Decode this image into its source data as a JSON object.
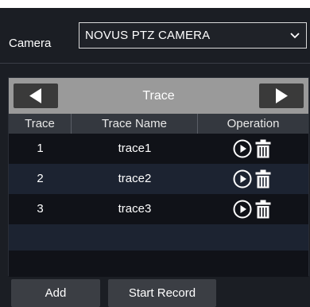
{
  "camera": {
    "label": "Camera",
    "selected": "NOVUS PTZ CAMERA"
  },
  "trace": {
    "title": "Trace",
    "columns": [
      "Trace",
      "Trace Name",
      "Operation"
    ],
    "rows": [
      {
        "id": "1",
        "name": "trace1"
      },
      {
        "id": "2",
        "name": "trace2"
      },
      {
        "id": "3",
        "name": "trace3"
      }
    ]
  },
  "buttons": {
    "add": "Add",
    "start_record": "Start Record"
  },
  "colors": {
    "background": "#1b1e24",
    "header": "#9a9a9a",
    "row_alt": "#1c2331",
    "row": "#101218"
  },
  "icons": {
    "prev": "triangle-left-icon",
    "next": "triangle-right-icon",
    "play": "play-circle-icon",
    "delete": "trash-icon",
    "dropdown": "chevron-down-icon"
  }
}
